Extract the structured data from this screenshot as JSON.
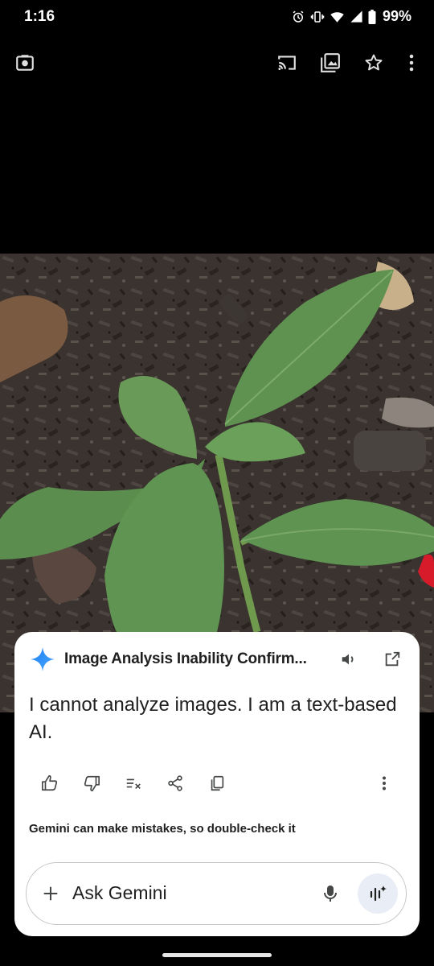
{
  "status_bar": {
    "time": "1:16",
    "battery": "99%",
    "icons": [
      "alarm-icon",
      "vibrate-icon",
      "wifi-icon",
      "signal-icon",
      "battery-icon"
    ]
  },
  "top_bar": {
    "icons": [
      "lens-icon",
      "cast-icon",
      "gallery-icon",
      "star-icon",
      "more-vert-icon"
    ]
  },
  "photo": {
    "description_icon": "photo-image"
  },
  "gemini_sheet": {
    "title": "Image Analysis Inability Confirm...",
    "answer": "I cannot analyze images. I am a text-based AI.",
    "action_icons": [
      "thumb-up-icon",
      "thumb-down-icon",
      "modify-response-icon",
      "share-icon",
      "copy-icon",
      "more-vert-icon"
    ],
    "disclaimer": "Gemini can make mistakes, so double-check it",
    "input": {
      "placeholder": "Ask Gemini"
    }
  },
  "colors": {
    "background": "#000000",
    "sheet": "#ffffff",
    "text": "#1f1f1f",
    "live_button": "#e9eef6",
    "gemini_blue": "#4285f4"
  }
}
